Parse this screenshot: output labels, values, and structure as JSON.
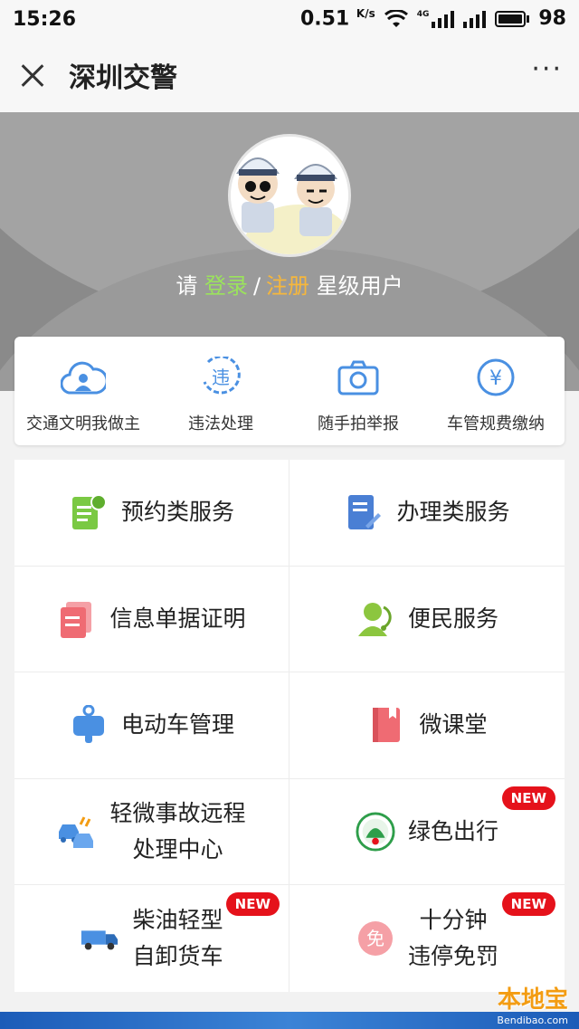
{
  "status_bar": {
    "time": "15:26",
    "speed": "0.51",
    "speed_unit": "K/s",
    "network": "4G",
    "battery": "98"
  },
  "title_bar": {
    "title": "深圳交警",
    "more": "···"
  },
  "hero": {
    "prefix": "请",
    "login": "登录",
    "slash": "/",
    "register": "注册",
    "suffix": "星级用户"
  },
  "quick_actions": [
    {
      "label": "交通文明我做主",
      "icon": "cloud-user-icon"
    },
    {
      "label": "违法处理",
      "icon": "violation-icon"
    },
    {
      "label": "随手拍举报",
      "icon": "camera-icon"
    },
    {
      "label": "车管规费缴纳",
      "icon": "yen-icon"
    }
  ],
  "services": [
    {
      "line1": "预约类服务",
      "line2": "",
      "icon": "appointment-icon",
      "color": "#7ac943",
      "badge": ""
    },
    {
      "line1": "办理类服务",
      "line2": "",
      "icon": "handling-icon",
      "color": "#4a7fd4",
      "badge": ""
    },
    {
      "line1": "信息单据证明",
      "line2": "",
      "icon": "document-icon",
      "color": "#ef6b73",
      "badge": ""
    },
    {
      "line1": "便民服务",
      "line2": "",
      "icon": "service-person-icon",
      "color": "#8cc63f",
      "badge": ""
    },
    {
      "line1": "电动车管理",
      "line2": "",
      "icon": "ebike-icon",
      "color": "#4a90e2",
      "badge": ""
    },
    {
      "line1": "微课堂",
      "line2": "",
      "icon": "book-icon",
      "color": "#ef6b73",
      "badge": ""
    },
    {
      "line1": "轻微事故远程",
      "line2": "处理中心",
      "icon": "accident-icon",
      "color": "#4a90e2",
      "badge": ""
    },
    {
      "line1": "绿色出行",
      "line2": "",
      "icon": "green-travel-icon",
      "color": "#2e9e4a",
      "badge": "NEW"
    },
    {
      "line1": "柴油轻型",
      "line2": "自卸货车",
      "icon": "truck-icon",
      "color": "#4a90e2",
      "badge": "NEW"
    },
    {
      "line1": "十分钟",
      "line2": "违停免罚",
      "icon": "exempt-icon",
      "color": "#ef6b73",
      "badge": "NEW"
    }
  ],
  "watermark": {
    "main": "本地宝",
    "sub": "Bendibao.com"
  }
}
